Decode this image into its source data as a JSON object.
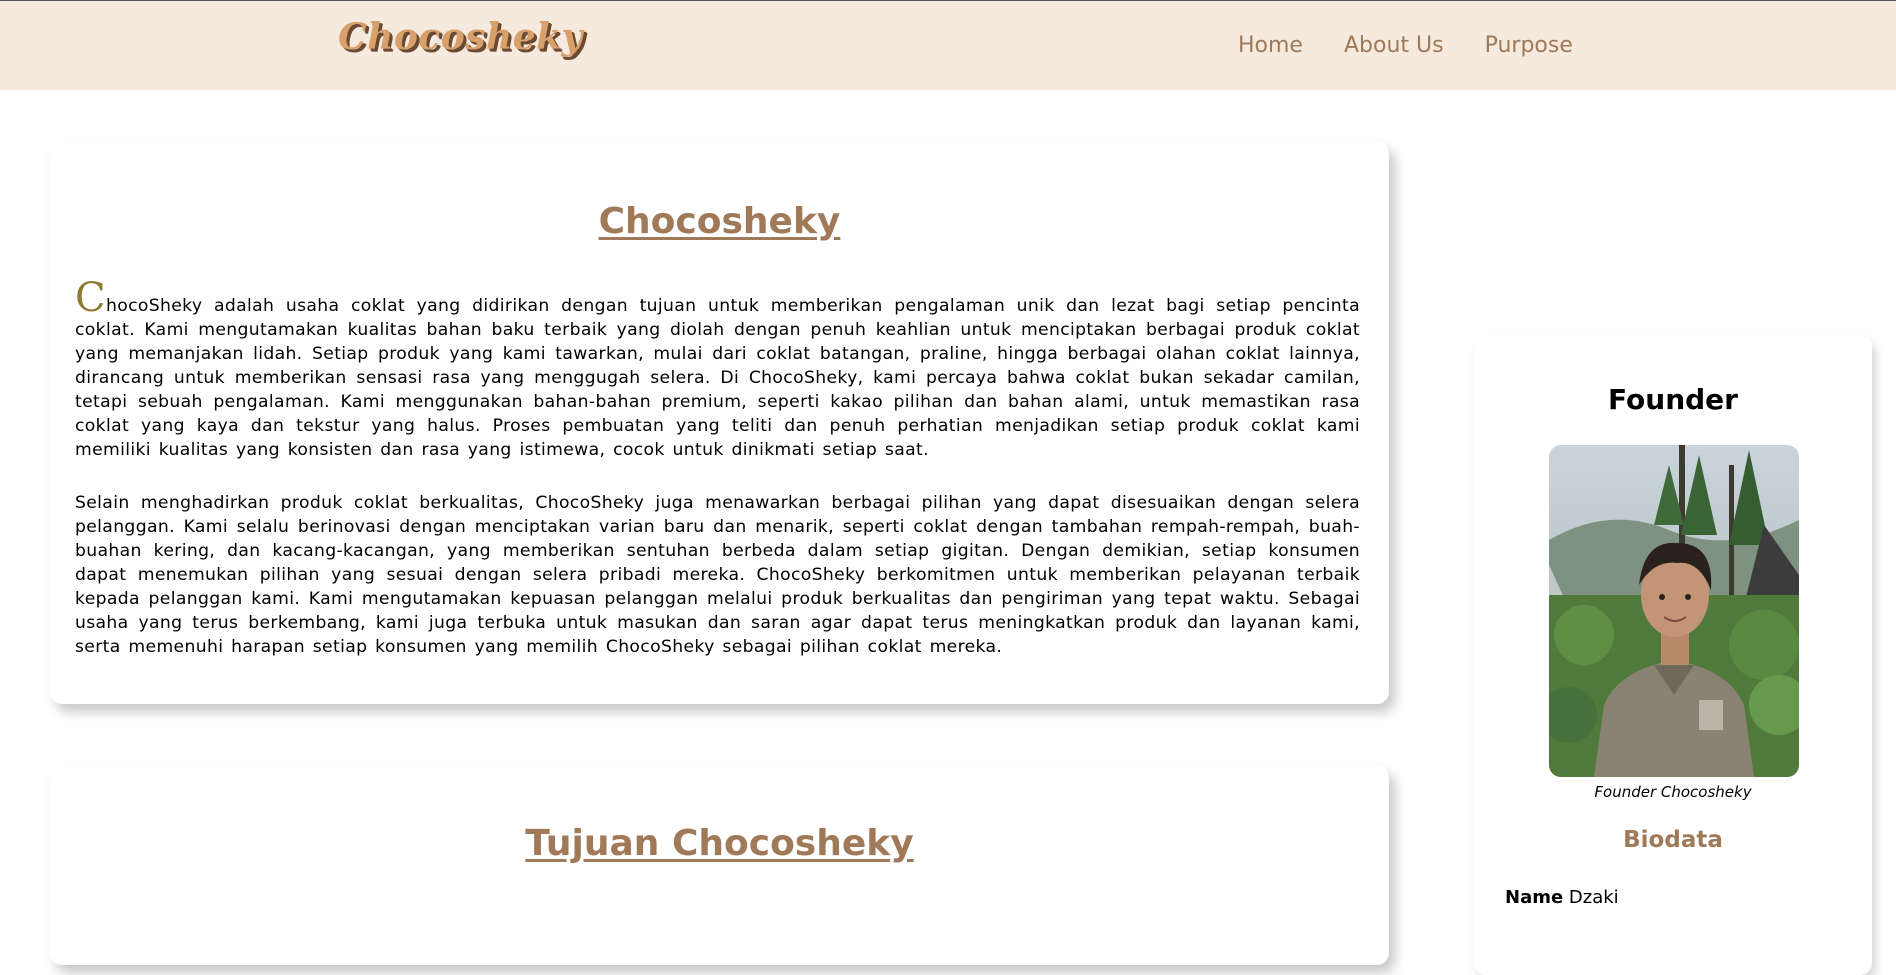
{
  "navbar": {
    "logo": "Chocosheky",
    "links": [
      {
        "label": "Home"
      },
      {
        "label": "About Us"
      },
      {
        "label": "Purpose"
      }
    ]
  },
  "about": {
    "title": "Chocosheky",
    "dropcap": "C",
    "paragraph1_rest": "hocoSheky adalah usaha coklat yang didirikan dengan tujuan untuk memberikan pengalaman unik dan lezat bagi setiap pencinta coklat. Kami mengutamakan kualitas bahan baku terbaik yang diolah dengan penuh keahlian untuk menciptakan berbagai produk coklat yang memanjakan lidah. Setiap produk yang kami tawarkan, mulai dari coklat batangan, praline, hingga berbagai olahan coklat lainnya, dirancang untuk memberikan sensasi rasa yang menggugah selera. Di ChocoSheky, kami percaya bahwa coklat bukan sekadar camilan, tetapi sebuah pengalaman. Kami menggunakan bahan-bahan premium, seperti kakao pilihan dan bahan alami, untuk memastikan rasa coklat yang kaya dan tekstur yang halus. Proses pembuatan yang teliti dan penuh perhatian menjadikan setiap produk coklat kami memiliki kualitas yang konsisten dan rasa yang istimewa, cocok untuk dinikmati setiap saat.",
    "paragraph2": "Selain menghadirkan produk coklat berkualitas, ChocoSheky juga menawarkan berbagai pilihan yang dapat disesuaikan dengan selera pelanggan. Kami selalu berinovasi dengan menciptakan varian baru dan menarik, seperti coklat dengan tambahan rempah-rempah, buah-buahan kering, dan kacang-kacangan, yang memberikan sentuhan berbeda dalam setiap gigitan. Dengan demikian, setiap konsumen dapat menemukan pilihan yang sesuai dengan selera pribadi mereka. ChocoSheky berkomitmen untuk memberikan pelayanan terbaik kepada pelanggan kami. Kami mengutamakan kepuasan pelanggan melalui produk berkualitas dan pengiriman yang tepat waktu. Sebagai usaha yang terus berkembang, kami juga terbuka untuk masukan dan saran agar dapat terus meningkatkan produk dan layanan kami, serta memenuhi harapan setiap konsumen yang memilih ChocoSheky sebagai pilihan coklat mereka."
  },
  "purpose": {
    "title": "Tujuan Chocosheky"
  },
  "founder": {
    "title": "Founder",
    "caption": "Founder Chocosheky",
    "bio_heading": "Biodata",
    "name_label": "Name",
    "name_value": "Dzaki"
  },
  "colors": {
    "navbar_bg": "#f6e9de",
    "accent_brown": "#a07a58",
    "dropcap_olive": "#8e7a32",
    "logo_tan": "#d8a06a"
  }
}
